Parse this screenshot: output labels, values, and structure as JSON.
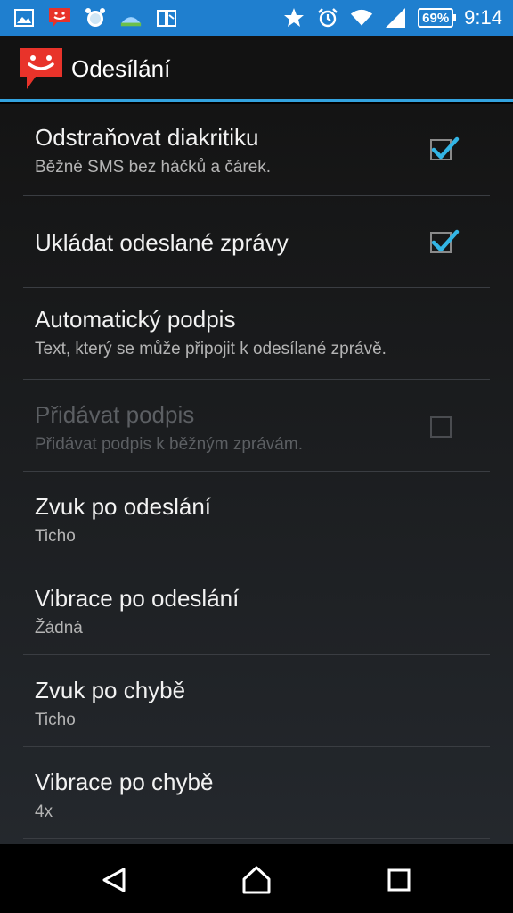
{
  "status_bar": {
    "battery": "69%",
    "time": "9:14",
    "left_icons": [
      "gallery-icon",
      "sms-notification-icon",
      "alarm-clock-app-icon",
      "weather-icon",
      "book-icon"
    ],
    "right_icons": [
      "star-icon",
      "alarm-icon",
      "wifi-icon",
      "signal-icon",
      "battery-icon"
    ]
  },
  "action_bar": {
    "title": "Odesílání",
    "accent": "#33a3df",
    "icon_color": "#e8332a"
  },
  "settings": [
    {
      "title": "Odstraňovat diakritiku",
      "summary": "Běžné SMS bez háčků a čárek.",
      "checkbox": true,
      "checked": true,
      "enabled": true
    },
    {
      "title": "Ukládat odeslané zprávy",
      "summary": "",
      "checkbox": true,
      "checked": true,
      "enabled": true
    },
    {
      "title": "Automatický podpis",
      "summary": "Text, který se může připojit k odesílané zprávě.",
      "checkbox": false,
      "enabled": true
    },
    {
      "title": "Přidávat podpis",
      "summary": "Přidávat podpis k běžným zprávám.",
      "checkbox": true,
      "checked": false,
      "enabled": false
    },
    {
      "title": "Zvuk po odeslání",
      "summary": "Ticho",
      "checkbox": false,
      "enabled": true
    },
    {
      "title": "Vibrace po odeslání",
      "summary": "Žádná",
      "checkbox": false,
      "enabled": true
    },
    {
      "title": "Zvuk po chybě",
      "summary": "Ticho",
      "checkbox": false,
      "enabled": true
    },
    {
      "title": "Vibrace po chybě",
      "summary": "4x",
      "checkbox": false,
      "enabled": true
    }
  ],
  "nav_bar": {
    "buttons": [
      "back-icon",
      "home-icon",
      "recents-icon"
    ]
  }
}
